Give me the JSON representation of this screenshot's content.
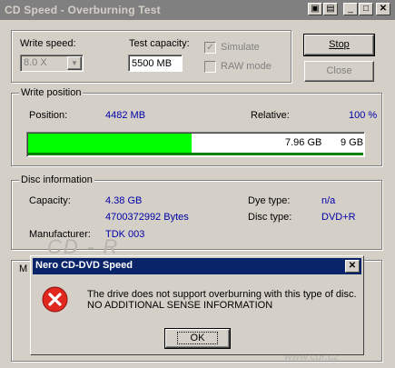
{
  "window": {
    "title": "CD Speed - Overburning Test",
    "buttons": [
      "minimize",
      "maximize",
      "close"
    ]
  },
  "settings": {
    "write_speed_label": "Write speed:",
    "write_speed_value": "8.0 X",
    "test_capacity_label": "Test capacity:",
    "test_capacity_value": "5500 MB",
    "simulate_label": "Simulate",
    "raw_mode_label": "RAW mode",
    "stop_label": "Stop",
    "close_label": "Close"
  },
  "write_position": {
    "group_label": "Write position",
    "position_label": "Position:",
    "position_value": "4482 MB",
    "relative_label": "Relative:",
    "relative_value": "100 %",
    "progress_fraction": 0.487,
    "progress_text_1": "7.96 GB",
    "progress_text_2": "9 GB"
  },
  "disc_information": {
    "group_label": "Disc information",
    "capacity_label": "Capacity:",
    "capacity_gb": "4.38 GB",
    "capacity_bytes": "4700372992 Bytes",
    "manufacturer_label": "Manufacturer:",
    "manufacturer_value": "TDK 003",
    "dye_type_label": "Dye type:",
    "dye_type_value": "n/a",
    "disc_type_label": "Disc type:",
    "disc_type_value": "DVD+R"
  },
  "log_group": {
    "label": "M"
  },
  "dialog": {
    "title": "Nero CD-DVD Speed",
    "message_line_1": "The drive does not support overburning with this type of disc.",
    "message_line_2": "NO ADDITIONAL SENSE INFORMATION",
    "ok_label": "OK"
  },
  "watermark": {
    "logo": "CD - R",
    "site": "www.cdr.cz"
  },
  "colors": {
    "progress_green": "#00ff00",
    "value_blue": "#0000a8",
    "dialog_title_bg": "#0a246a",
    "error_red": "#e0281e"
  }
}
